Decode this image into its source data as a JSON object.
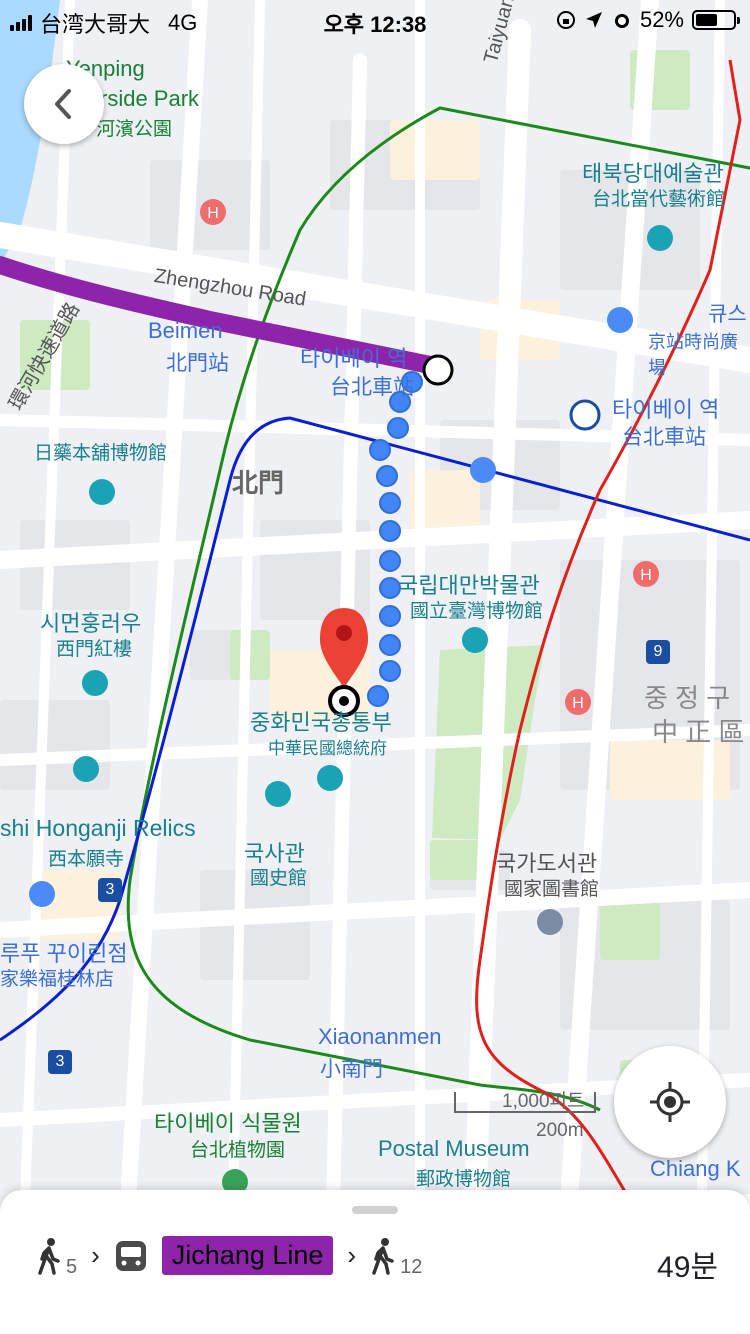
{
  "status": {
    "carrier": "台湾大哥大",
    "network": "4G",
    "time": "오후 12:38",
    "battery": "52%"
  },
  "map_labels": {
    "yenping1": "Yenping",
    "yenping2": "Riverside Park",
    "yenping_zh": "延平河濱公園",
    "taiyuan": "Taiyuan Road",
    "zhengzhou": "Zhengzhou Road",
    "moca_ko": "태북당대예술관",
    "moca_zh": "台北當代藝術館",
    "q_ko": "큐스",
    "q_zh": "京站時尚廣場",
    "beimen_en": "Beimen",
    "beimen_zh": "北門站",
    "station_ko": "타이베이 역",
    "station_zh": "台北車站",
    "station2_ko": "타이베이 역",
    "station2_zh": "台北車站",
    "beimen_gate": "北門",
    "kiosk": "日藥本舖博物館",
    "museum_ko": "국립대만박물관",
    "museum_zh": "國立臺灣博物館",
    "ximen_ko": "시먼훙러우",
    "ximen_zh": "西門紅樓",
    "office_ko": "중화민국총통부",
    "office_zh": "中華民國總統府",
    "zhongzheng_ko": "중 정 구",
    "zhongzheng_zh": "中 正 區",
    "honganji": "shi Honganji Relics",
    "honganji_zh": "西本願寺",
    "history_ko": "국사관",
    "history_zh": "國史館",
    "library_ko": "국가도서관",
    "library_zh": "國家圖書館",
    "carrefour_ko": "루푸 꾸이린점",
    "carrefour_zh": "家樂福桂林店",
    "xiaonanmen_en": "Xiaonanmen",
    "xiaonanmen_zh": "小南門",
    "botanical_ko": "타이베이 식물원",
    "botanical_zh": "台北植物園",
    "postal_en": "Postal Museum",
    "postal_zh": "郵政博物館",
    "chiang": "Chiang K",
    "expressway": "環河快速道路",
    "route9": "9",
    "route3a": "3",
    "route3b": "3",
    "scale_ft": "1,000피트",
    "scale_m": "200m"
  },
  "colors": {
    "purple_line": "#8e24aa",
    "green_line": "#1b8a1b",
    "blue_line": "#0a1fd1",
    "red_line": "#e0201b",
    "walk_dots": "#4285f4",
    "pin": "#ea4335",
    "park": "#cdeac0",
    "water": "#aadaff"
  },
  "icons": {
    "back": "chevron-left-icon",
    "locate": "my-location-icon",
    "walk": "walk-icon",
    "bus": "bus-icon"
  },
  "directions": {
    "walk1_minutes": "5",
    "line_name": "Jichang Line",
    "walk2_minutes": "12",
    "duration": "49분"
  }
}
